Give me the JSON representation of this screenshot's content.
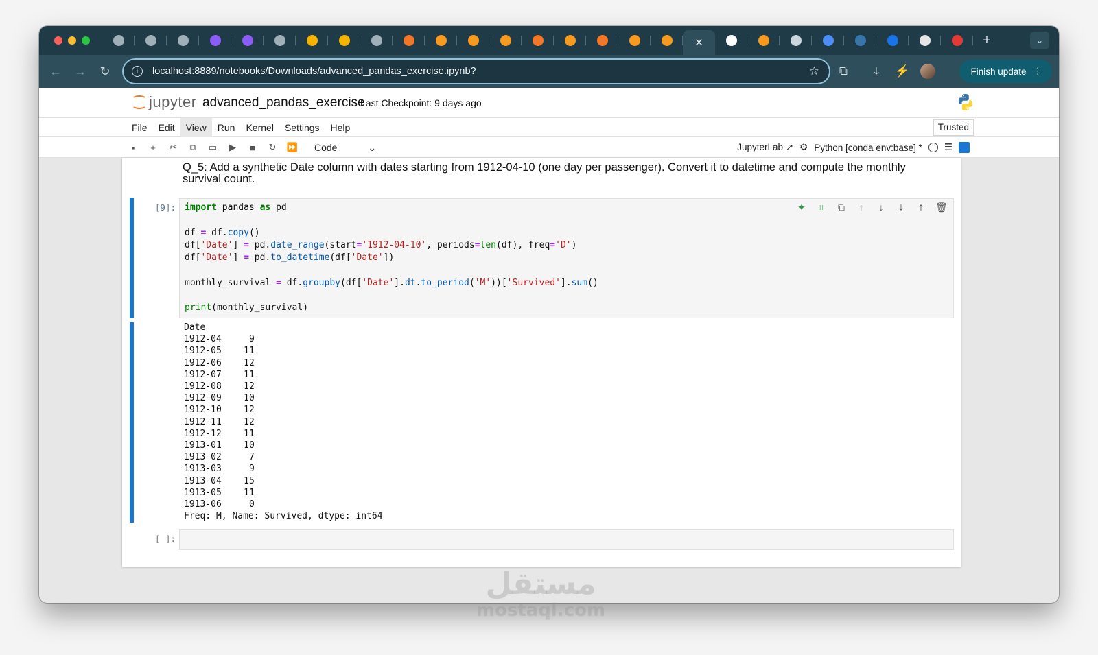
{
  "browser": {
    "address_url": "localhost:8889/notebooks/Downloads/advanced_pandas_exercise.ipynb?",
    "finish_update_label": "Finish update",
    "new_tab_icon": "plus-icon",
    "tab_icon_colors": [
      "#9fb0b8",
      "#9fb0b8",
      "#9fb0b8",
      "#8b5cf6",
      "#8b5cf6",
      "#9fb0b8",
      "#f4b400",
      "#f4b400",
      "#9fb0b8",
      "#f37726",
      "#f79a1e",
      "#f79a1e",
      "#f79a1e",
      "#f37726",
      "#f79a1e",
      "#f37726",
      "#f79a1e",
      "#f79a1e",
      "#ffffff",
      "#f79a1e",
      "#c9d5da",
      "#4c8df6",
      "#3776ab",
      "#1a73e8",
      "#e6e6e6",
      "#e53935"
    ]
  },
  "jupyter": {
    "logo_text": "jupyter",
    "notebook_title": "advanced_pandas_exercise",
    "checkpoint": "Last Checkpoint: 9 days ago",
    "menu": [
      "File",
      "Edit",
      "View",
      "Run",
      "Kernel",
      "Settings",
      "Help"
    ],
    "trusted_label": "Trusted",
    "cell_type": "Code",
    "jupyterlab_link": "JupyterLab",
    "kernel_name": "Python [conda env:base]",
    "kernel_status_mark": "*"
  },
  "notebook": {
    "markdown_text": "Q_5: Add a synthetic Date column with dates starting from 1912-04-10 (one day per passenger). Convert it to datetime and compute the monthly survival count.",
    "code_cell_prompt": "[9]:",
    "output_header": "Date",
    "output_rows": [
      {
        "period": "1912-04",
        "count": "9"
      },
      {
        "period": "1912-05",
        "count": "11"
      },
      {
        "period": "1912-06",
        "count": "12"
      },
      {
        "period": "1912-07",
        "count": "11"
      },
      {
        "period": "1912-08",
        "count": "12"
      },
      {
        "period": "1912-09",
        "count": "10"
      },
      {
        "period": "1912-10",
        "count": "12"
      },
      {
        "period": "1912-11",
        "count": "12"
      },
      {
        "period": "1912-12",
        "count": "11"
      },
      {
        "period": "1913-01",
        "count": "10"
      },
      {
        "period": "1913-02",
        "count": "7"
      },
      {
        "period": "1913-03",
        "count": "9"
      },
      {
        "period": "1913-04",
        "count": "15"
      },
      {
        "period": "1913-05",
        "count": "11"
      },
      {
        "period": "1913-06",
        "count": "0"
      }
    ],
    "output_footer": "Freq: M, Name: Survived, dtype: int64",
    "empty_cell_prompt": "[ ]:"
  },
  "watermark": {
    "arabic": "مستقل",
    "latin": "mostaql.com"
  }
}
